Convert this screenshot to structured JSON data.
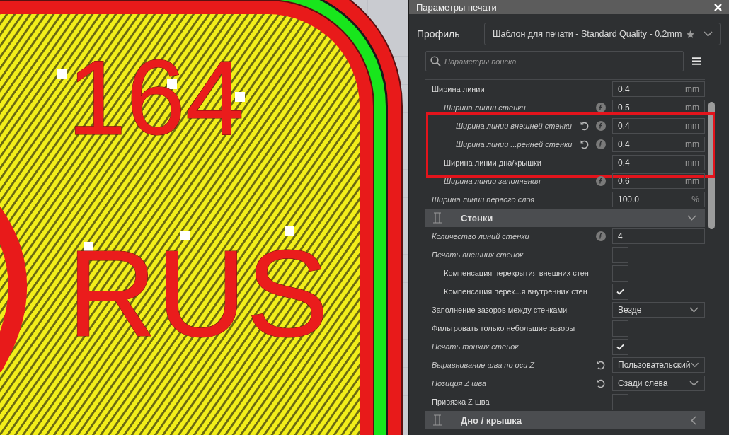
{
  "viewport": {
    "model_texts": [
      "164",
      "RUS"
    ]
  },
  "panel": {
    "title": "Параметры печати",
    "profile": {
      "label": "Профиль",
      "value": "Шаблон для печати - Standard Quality - 0.2mm"
    },
    "search": {
      "placeholder": "Параметры поиска"
    },
    "settings": [
      {
        "kind": "setting",
        "label": "Ширина линии",
        "computed": false,
        "reset": false,
        "inherit": false,
        "highlighted": false,
        "control": {
          "kind": "number",
          "value": "0.4",
          "unit": "mm"
        },
        "children": [
          {
            "kind": "setting",
            "label": "Ширина линии стенки",
            "computed": true,
            "reset": false,
            "inherit": true,
            "highlighted": false,
            "control": {
              "kind": "number",
              "value": "0.5",
              "unit": "mm"
            },
            "children": [
              {
                "kind": "setting",
                "label": "Ширина линии внешней стенки",
                "computed": true,
                "reset": true,
                "inherit": true,
                "highlighted": true,
                "control": {
                  "kind": "number",
                  "value": "0.4",
                  "unit": "mm"
                }
              },
              {
                "kind": "setting",
                "label": "Ширина линии ...ренней стенки",
                "computed": true,
                "reset": true,
                "inherit": true,
                "highlighted": true,
                "control": {
                  "kind": "number",
                  "value": "0.4",
                  "unit": "mm"
                }
              }
            ]
          },
          {
            "kind": "setting",
            "label": "Ширина линии дна/крышки",
            "computed": false,
            "reset": false,
            "inherit": false,
            "highlighted": true,
            "control": {
              "kind": "number",
              "value": "0.4",
              "unit": "mm"
            }
          },
          {
            "kind": "setting",
            "label": "Ширина линии заполнения",
            "computed": true,
            "reset": false,
            "inherit": true,
            "highlighted": false,
            "control": {
              "kind": "number",
              "value": "0.6",
              "unit": "mm"
            }
          }
        ]
      },
      {
        "kind": "setting",
        "label": "Ширина линии первого слоя",
        "computed": true,
        "reset": false,
        "inherit": false,
        "highlighted": false,
        "control": {
          "kind": "number",
          "value": "100.0",
          "unit": "%"
        }
      },
      {
        "kind": "section",
        "label": "Стенки",
        "expanded": true,
        "children": [
          {
            "kind": "setting",
            "label": "Количество линий стенки",
            "computed": true,
            "reset": false,
            "inherit": true,
            "highlighted": false,
            "control": {
              "kind": "number",
              "value": "4"
            }
          },
          {
            "kind": "setting",
            "label": "Печать внешних стенок",
            "computed": true,
            "reset": false,
            "inherit": false,
            "highlighted": false,
            "control": {
              "kind": "checkbox",
              "checked": false
            },
            "children": [
              {
                "kind": "setting",
                "label": "Компенсация перекрытия внешних стен",
                "computed": false,
                "reset": false,
                "inherit": false,
                "highlighted": false,
                "control": {
                  "kind": "checkbox",
                  "checked": false
                }
              },
              {
                "kind": "setting",
                "label": "Компенсация перек...я внутренних стен",
                "computed": false,
                "reset": false,
                "inherit": false,
                "highlighted": false,
                "control": {
                  "kind": "checkbox",
                  "checked": true
                }
              }
            ]
          },
          {
            "kind": "setting",
            "label": "Заполнение зазоров между стенками",
            "computed": false,
            "reset": false,
            "inherit": false,
            "highlighted": false,
            "control": {
              "kind": "dropdown",
              "value": "Везде"
            }
          },
          {
            "kind": "setting",
            "label": "Фильтровать только небольшие зазоры",
            "computed": false,
            "reset": false,
            "inherit": false,
            "highlighted": false,
            "control": {
              "kind": "checkbox",
              "checked": false
            }
          },
          {
            "kind": "setting",
            "label": "Печать тонких стенок",
            "computed": true,
            "reset": false,
            "inherit": false,
            "highlighted": false,
            "control": {
              "kind": "checkbox",
              "checked": true
            }
          },
          {
            "kind": "setting",
            "label": "Выравнивание шва по оси Z",
            "computed": true,
            "reset": true,
            "inherit": false,
            "highlighted": false,
            "control": {
              "kind": "dropdown",
              "value": "Пользовательский"
            }
          },
          {
            "kind": "setting",
            "label": "Позиция Z шва",
            "computed": true,
            "reset": true,
            "inherit": false,
            "highlighted": false,
            "control": {
              "kind": "dropdown",
              "value": "Сзади слева"
            }
          },
          {
            "kind": "setting",
            "label": "Привязка Z шва",
            "computed": false,
            "reset": false,
            "inherit": false,
            "highlighted": false,
            "control": {
              "kind": "checkbox",
              "checked": false
            }
          }
        ]
      },
      {
        "kind": "section",
        "label": "Дно / крышка",
        "expanded": false
      }
    ]
  }
}
